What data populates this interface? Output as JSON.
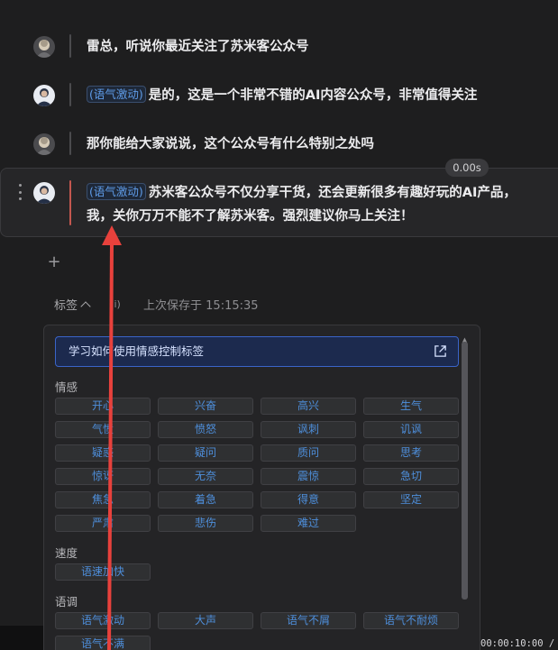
{
  "dialogue": [
    {
      "speaker": "host",
      "tag": "",
      "text": "雷总，听说你最近关注了苏米客公众号"
    },
    {
      "speaker": "guest",
      "tag": "(语气激动)",
      "text": "是的，这是一个非常不错的AI内容公众号，非常值得关注"
    },
    {
      "speaker": "host",
      "tag": "",
      "text": "那你能给大家说说，这个公众号有什么特别之处吗"
    },
    {
      "speaker": "guest",
      "tag": "(语气激动)",
      "text_line1": "苏米客公众号不仅分享干货，还会更新很多有趣好玩的AI产品，",
      "text_line2": "我，关你万万不能不了解苏米客。强烈建议你马上关注！",
      "time": "0.00s"
    }
  ],
  "toolbar": {
    "tags_label": "标签",
    "info_label": "(i)",
    "save_status": "上次保存于 15:15:35",
    "add_symbol": "+"
  },
  "panel": {
    "learn_label": "学习如何使用情感控制标签",
    "sections": [
      {
        "title": "情感",
        "chips": [
          "开心",
          "兴奋",
          "高兴",
          "生气",
          "气愤",
          "愤怒",
          "讽刺",
          "讥讽",
          "疑惑",
          "疑问",
          "质问",
          "思考",
          "惊讶",
          "无奈",
          "震惊",
          "急切",
          "焦急",
          "着急",
          "得意",
          "坚定",
          "严肃",
          "悲伤",
          "难过"
        ]
      },
      {
        "title": "速度",
        "chips": [
          "语速加快"
        ]
      },
      {
        "title": "语调",
        "chips": [
          "语气激动",
          "大声",
          "语气不屑",
          "语气不耐烦",
          "语气不满"
        ]
      }
    ]
  },
  "bottom_time": "00:00:10:00 /",
  "colors": {
    "accent": "#3a64c8",
    "chip_text": "#4e8fdc",
    "active_bar": "#c4574f",
    "arrow": "#e8413c"
  }
}
